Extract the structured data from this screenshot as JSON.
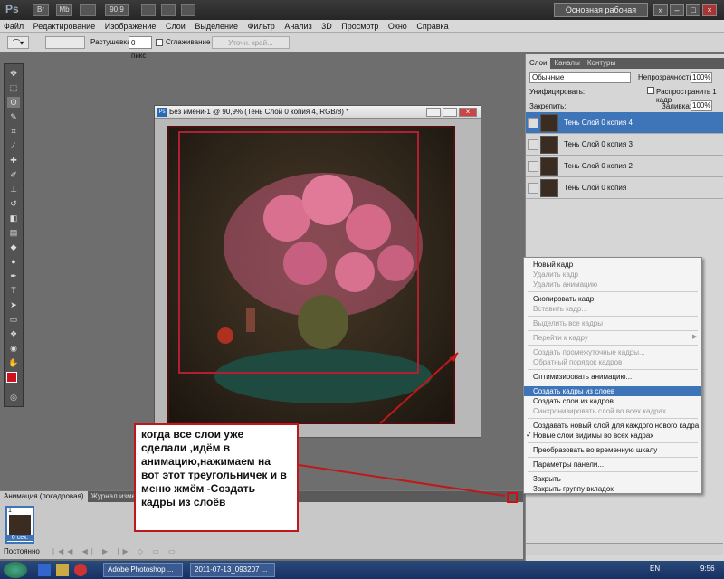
{
  "titlebar": {
    "logo": "Ps",
    "btn_br": "Br",
    "btn_mb": "Mb",
    "zoom": "90,9",
    "workspace": "Основная рабочая среда"
  },
  "menu_items": [
    "Файл",
    "Редактирование",
    "Изображение",
    "Слои",
    "Выделение",
    "Фильтр",
    "Анализ",
    "3D",
    "Просмотр",
    "Окно",
    "Справка"
  ],
  "options": {
    "feather_label": "Растушевка:",
    "feather_value": "0 пикс",
    "antialias": "Сглаживание",
    "refine": "Уточн. край..."
  },
  "document": {
    "title": "Без имени-1 @ 90,9% (Тень Слой 0 копия 4, RGB/8) *"
  },
  "layers_panel": {
    "tabs": [
      "Слои",
      "Каналы",
      "Контуры"
    ],
    "blend": "Обычные",
    "opacity_label": "Непрозрачность:",
    "opacity": "100%",
    "unify_label": "Унифицировать:",
    "propagate": "Распространить 1 кадр",
    "lock_label": "Закрепить:",
    "fill_label": "Заливка:",
    "fill": "100%",
    "layers": [
      "Тень Слой 0 копия 4",
      "Тень Слой 0 копия 3",
      "Тень Слой 0 копия 2",
      "Тень Слой 0 копия"
    ]
  },
  "context_menu": [
    {
      "label": "Новый кадр",
      "state": "normal"
    },
    {
      "label": "Удалить кадр",
      "state": "dis"
    },
    {
      "label": "Удалить анимацию",
      "state": "dis"
    },
    {
      "label": "Скопировать кадр",
      "state": "normal"
    },
    {
      "label": "Вставить кадр...",
      "state": "dis"
    },
    {
      "label": "Выделить все кадры",
      "state": "dis"
    },
    {
      "label": "Перейти к кадру",
      "state": "dis"
    },
    {
      "label": "Создать промежуточные кадры...",
      "state": "dis"
    },
    {
      "label": "Обратный порядок кадров",
      "state": "dis"
    },
    {
      "label": "Оптимизировать анимацию...",
      "state": "normal"
    },
    {
      "label": "Создать кадры из слоев",
      "state": "hl"
    },
    {
      "label": "Создать слои из кадров",
      "state": "normal"
    },
    {
      "label": "Синхронизировать слой во всех кадрах...",
      "state": "dis"
    },
    {
      "label": "Создавать новый слой для каждого нового кадра",
      "state": "normal"
    },
    {
      "label": "Новые слои видимы во всех кадрах",
      "state": "normal"
    },
    {
      "label": "Преобразовать во временную шкалу",
      "state": "normal"
    },
    {
      "label": "Параметры панели...",
      "state": "normal"
    },
    {
      "label": "Закрыть",
      "state": "normal"
    },
    {
      "label": "Закрыть группу вкладок",
      "state": "normal"
    }
  ],
  "animation": {
    "tabs": [
      "Анимация (покадровая)",
      "Журнал измерений"
    ],
    "frame_num": "1",
    "frame_time": "0 сек.",
    "loop": "Постоянно"
  },
  "callout": "когда все слои уже сделали ,идём в анимацию,нажимаем  на вот этот треугольничек и в меню жмём -Создать кадры из слоёв",
  "taskbar": {
    "start": "",
    "tasks": [
      "Adobe Photoshop ...",
      "2011-07-13_093207 ..."
    ],
    "lang": "EN",
    "time": "9:56"
  }
}
